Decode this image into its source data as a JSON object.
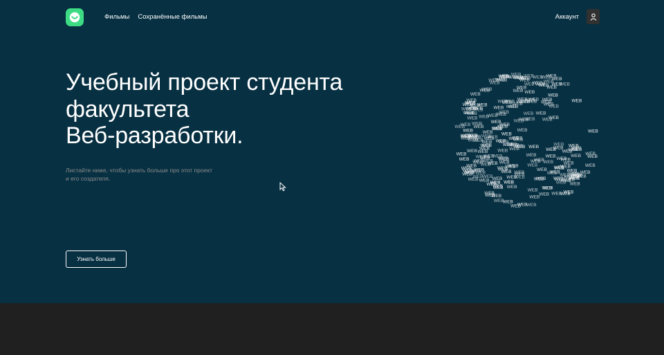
{
  "colors": {
    "hero_background": "#073042",
    "footer_background": "#202020",
    "logo_green": "#3ddc84",
    "subtitle_gray": "#8b8b8b"
  },
  "header": {
    "logo_icon": "smile-logo-icon",
    "nav": [
      "Фильмы",
      "Сохранённые фильмы"
    ],
    "account_label": "Аккаунт",
    "avatar_icon": "user-icon"
  },
  "hero": {
    "title_lines": [
      "Учебный проект студента",
      "факультета",
      "Веб-разработки."
    ],
    "subtitle": "Листайте ниже, чтобы узнать больше про этот проект и его создателя.",
    "cta_label": "Узнать больше",
    "globe_word": "WEB"
  }
}
